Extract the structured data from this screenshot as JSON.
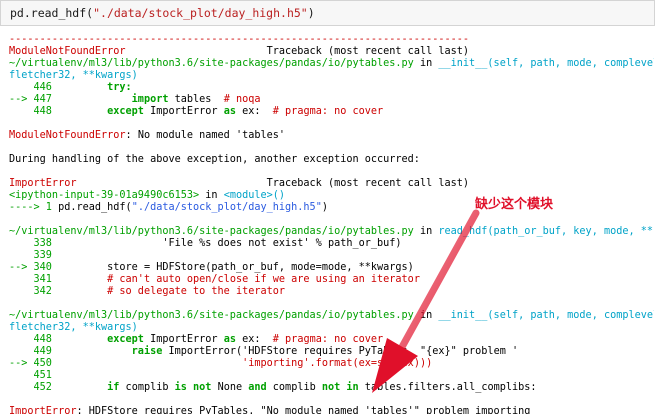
{
  "input_cell": {
    "code_prefix": "pd.read_hdf(",
    "code_string": "\"./data/stock_plot/day_high.h5\"",
    "code_suffix": ")"
  },
  "traceback": {
    "dashes": "---------------------------------------------------------------------------",
    "err1_name": "ModuleNotFoundError",
    "err1_header": "                       Traceback (most recent call last)",
    "file1_path": "~/virtualenv/ml3/lib/python3.6/site-packages/pandas/io/pytables.py",
    "file1_in": " in ",
    "file1_func": "__init__(self, path, mode, complevel, compli",
    "file1_cont": "fletcher32, **kwargs)",
    "f1_l446_no": "    446 ",
    "f1_l446_code": "        try:",
    "f1_l447_arrow": "--> 447 ",
    "f1_l447_kw": "            import",
    "f1_l447_code": " tables  ",
    "f1_l447_comment": "# noqa",
    "f1_l448_no": "    448 ",
    "f1_l448_kw": "        except",
    "f1_l448_code": " ImportError ",
    "f1_l448_kw2": "as",
    "f1_l448_code2": " ex:  ",
    "f1_l448_comment": "# pragma: no cover",
    "err1_msg_name": "ModuleNotFoundError",
    "err1_msg": ": No module named 'tables'",
    "during": "During handling of the above exception, another exception occurred:",
    "err2_name": "ImportError",
    "err2_header": "                               Traceback (most recent call last)",
    "ipy_input": "<ipython-input-39-01a9490c6153>",
    "ipy_in": " in ",
    "ipy_module": "<module>()",
    "ipy_arrow": "----> 1 ",
    "ipy_code_prefix": "pd.read_hdf(",
    "ipy_code_string": "\"./data/stock_plot/day_high.h5\"",
    "ipy_code_suffix": ")",
    "file2_path": "~/virtualenv/ml3/lib/python3.6/site-packages/pandas/io/pytables.py",
    "file2_in": " in ",
    "file2_func": "read_hdf(path_or_buf, key, mode, **kwargs)",
    "f2_l338_no": "    338 ",
    "f2_l338_code": "                 'File %s does not exist' % path_or_buf)",
    "f2_l339_no": "    339",
    "f2_l340_arrow": "--> 340 ",
    "f2_l340_code": "        store = HDFStore(path_or_buf, mode=mode, **kwargs)",
    "f2_l341_no": "    341 ",
    "f2_l341_comment": "        # can't auto open/close if we are using an iterator",
    "f2_l342_no": "    342 ",
    "f2_l342_comment": "        # so delegate to the iterator",
    "file3_path": "~/virtualenv/ml3/lib/python3.6/site-packages/pandas/io/pytables.py",
    "file3_in": " in ",
    "file3_func": "__init__(self, path, mode, complevel, compli",
    "file3_cont": "fletcher32, **kwargs)",
    "f3_l448_no": "    448 ",
    "f3_l448_kw": "        except",
    "f3_l448_code": " ImportError ",
    "f3_l448_kw2": "as",
    "f3_l448_code2": " ex:  ",
    "f3_l448_comment": "# pragma: no cover",
    "f3_l449_no": "    449 ",
    "f3_l449_kw": "            raise",
    "f3_l449_code": " ImportError('HDFStore requires PyTables, \"{ex}\" problem '",
    "f3_l450_arrow": "--> 450 ",
    "f3_l450_code": "                              'importing'.format(ex=str(ex)))",
    "f3_l451_no": "    451",
    "f3_l452_no": "    452 ",
    "f3_l452_kw": "        if",
    "f3_l452_code": " complib ",
    "f3_l452_kw2": "is not",
    "f3_l452_code2": " None ",
    "f3_l452_kw3": "and",
    "f3_l452_code3": " complib ",
    "f3_l452_kw4": "not in",
    "f3_l452_code4": " tables.filters.all_complibs:",
    "final_name": "ImportError",
    "final_msg": ": HDFStore requires PyTables, \"No module named 'tables'\" problem importing"
  },
  "annotation": {
    "label": "缺少这个模块",
    "color": "#e0102a"
  }
}
